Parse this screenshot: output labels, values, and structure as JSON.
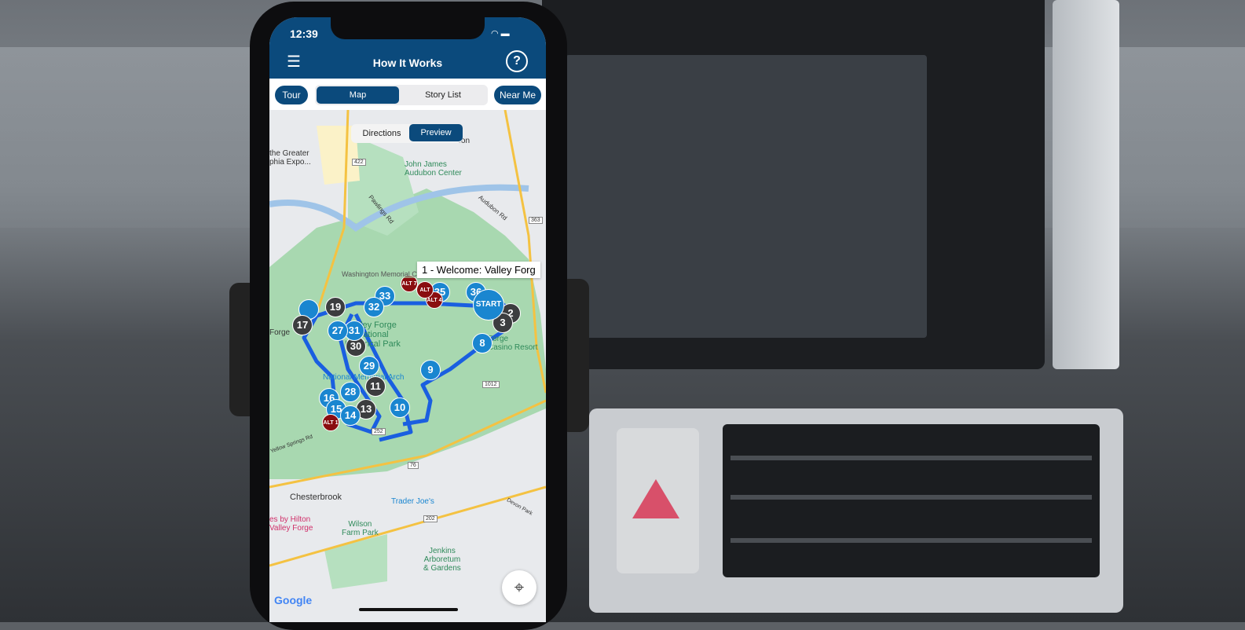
{
  "status": {
    "time": "12:39",
    "location_icon": "location-arrow-icon",
    "wifi_icon": "wifi-icon",
    "battery_icon": "battery-icon"
  },
  "header": {
    "title": "How It Works",
    "menu_icon": "hamburger-menu-icon",
    "help_label": "?"
  },
  "nav": {
    "tour": "Tour",
    "segments": [
      {
        "label": "Map",
        "selected": true
      },
      {
        "label": "Story List",
        "selected": false
      }
    ],
    "near_me": "Near Me"
  },
  "map_mode": {
    "directions": "Directions",
    "preview": "Preview",
    "selected": "Preview"
  },
  "callout": "1 - Welcome: Valley Forg",
  "markers": {
    "start": "START",
    "blue": [
      "36",
      "35",
      "8",
      "9",
      "10",
      "14",
      "15",
      "16",
      "28",
      "29",
      "31",
      "27",
      "32",
      "33"
    ],
    "gray": [
      "2",
      "3",
      "11",
      "13",
      "30",
      "19",
      "17"
    ],
    "alt": [
      "ALT 1",
      "ALT 4",
      "ALT 7",
      "ALT"
    ]
  },
  "map_labels": {
    "expo": "the Greater\nphia Expo...",
    "audubon": "Audubon",
    "audubon_center": "John James\nAudubon Center",
    "pawlings": "Pawlings Rd",
    "audubon_rd": "Audubon Rd",
    "washington": "Washington Memorial Chapel",
    "park": "Valley Forge\nNational\nHistorical Park",
    "forge": "Forge",
    "arch": "National Memorial Arch",
    "casino": "Forge\nCasino Resort",
    "chesterbrook": "Chesterbrook",
    "trader": "Trader Joe's",
    "hilton": "es by Hilton\nValley Forge",
    "wilson": "Wilson\nFarm Park",
    "jenkins": "Jenkins\nArboretum\n& Gardens",
    "yellow_springs": "Yellow Springs Rd",
    "devon": "Devon Park",
    "google": "Google",
    "routes": [
      "422",
      "363",
      "1012",
      "252",
      "76",
      "202"
    ]
  },
  "colors": {
    "brand": "#0b4a7c",
    "marker_blue": "#1a86d0",
    "marker_gray": "#3c3d3f",
    "marker_alt": "#8a0e10",
    "route": "#1a5fe0",
    "park": "#a8d8b0"
  }
}
